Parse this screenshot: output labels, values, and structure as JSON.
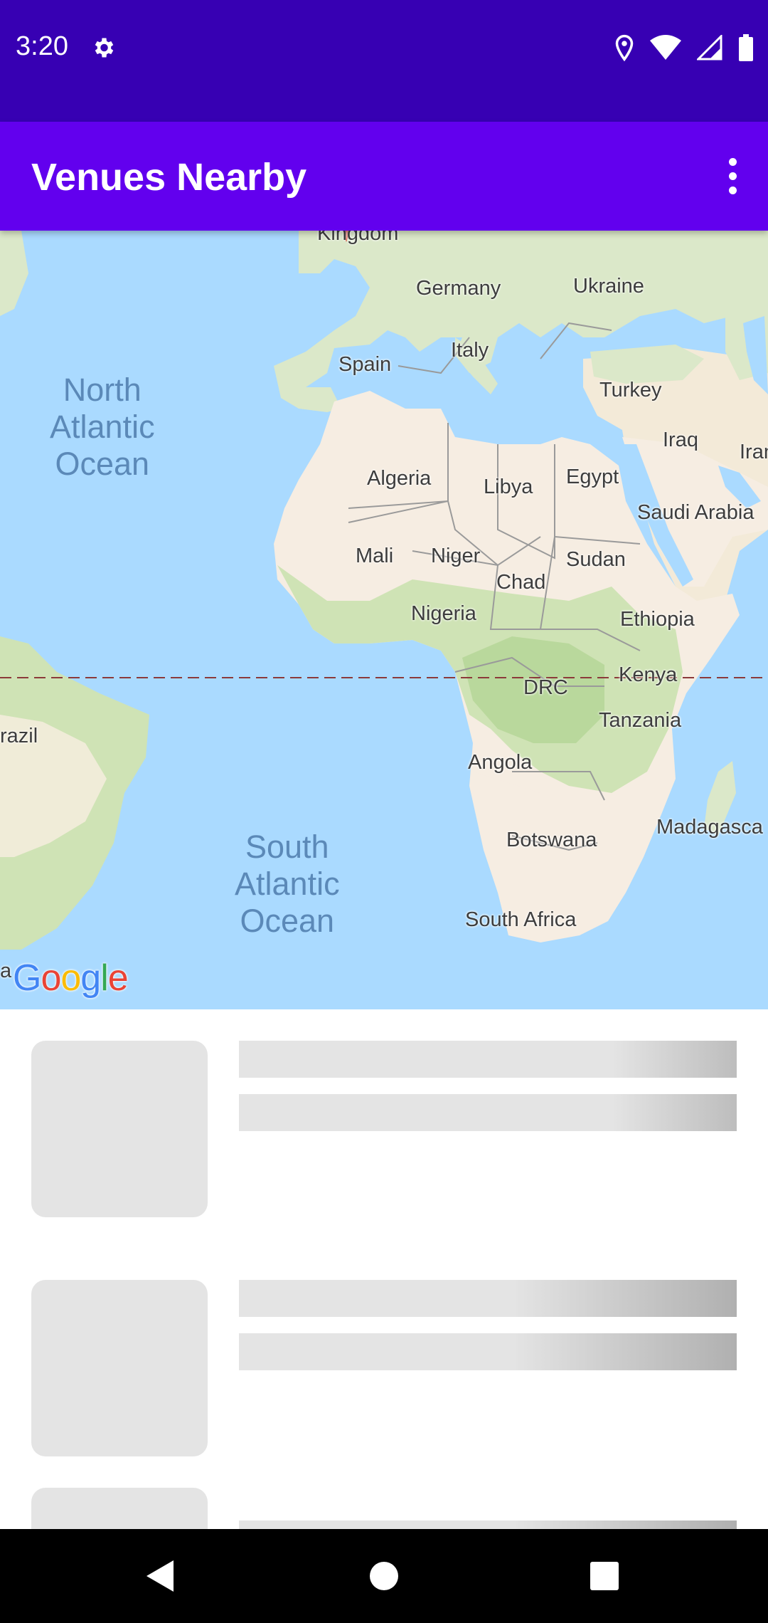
{
  "status_bar": {
    "time": "3:20",
    "icons": [
      "settings-icon",
      "location-icon",
      "wifi-icon",
      "signal-icon",
      "battery-icon"
    ]
  },
  "app_bar": {
    "title": "Venues Nearby",
    "menu_icon": "more-vert-icon"
  },
  "map": {
    "oceans": [
      {
        "id": "north-atlantic",
        "text": "North\nAtlantic\nOcean"
      },
      {
        "id": "south-atlantic",
        "text": "South\nAtlantic\nOcean"
      }
    ],
    "labels": {
      "kingdom": "Kingdom",
      "germany": "Germany",
      "ukraine": "Ukraine",
      "spain": "Spain",
      "italy": "Italy",
      "turkey": "Turkey",
      "iraq": "Iraq",
      "iran": "Iran",
      "algeria": "Algeria",
      "libya": "Libya",
      "egypt": "Egypt",
      "saudi_arabia": "Saudi Arabia",
      "mali": "Mali",
      "niger": "Niger",
      "chad": "Chad",
      "sudan": "Sudan",
      "nigeria": "Nigeria",
      "ethiopia": "Ethiopia",
      "kenya": "Kenya",
      "drc": "DRC",
      "tanzania": "Tanzania",
      "brazil": "razil",
      "angola": "Angola",
      "botswana": "Botswana",
      "madagascar": "Madagasca",
      "south_africa": "South Africa"
    },
    "attribution": "Google",
    "attribution_prefix": "a"
  },
  "list": {
    "placeholder_count": 3
  },
  "colors": {
    "status_bar": "#3700b3",
    "app_bar": "#6200ee",
    "water": "#aadaff",
    "land": "#f6f0e4",
    "placeholder": "#e4e4e4"
  }
}
